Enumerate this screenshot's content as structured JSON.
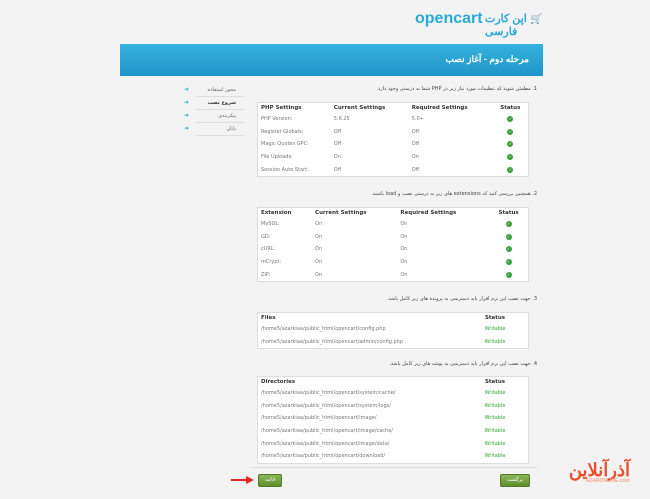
{
  "logo": {
    "brand": "opencart",
    "brand_fa": "اپن کارت فارسی"
  },
  "banner": {
    "title": "مرحله دوم - آغاز نصب"
  },
  "sidebar": {
    "items": [
      {
        "label": "مجوز استفاده",
        "active": false
      },
      {
        "label": "شروع نصب",
        "active": true
      },
      {
        "label": "پیکربندی",
        "active": false
      },
      {
        "label": "پایان",
        "active": false
      }
    ]
  },
  "section1": {
    "text": "1. مطمئن شوید که تنظیمات مورد نیاز زیر در PHP شما به درستی وجود دارد.",
    "headers": [
      "PHP Settings",
      "Current Settings",
      "Required Settings",
      "Status"
    ],
    "rows": [
      [
        "PHP Version:",
        "5.6.25",
        "5.0+"
      ],
      [
        "Register Globals:",
        "Off",
        "Off"
      ],
      [
        "Magic Quotes GPC:",
        "Off",
        "Off"
      ],
      [
        "File Uploads:",
        "On",
        "On"
      ],
      [
        "Session Auto Start:",
        "Off",
        "Off"
      ]
    ]
  },
  "section2": {
    "text": "2. همچنین بررسی کنید که extensions های زیر به درستی نصب و load باشند.",
    "headers": [
      "Extension",
      "Current Settings",
      "Required Settings",
      "Status"
    ],
    "rows": [
      [
        "MySQL:",
        "On",
        "On"
      ],
      [
        "GD:",
        "On",
        "On"
      ],
      [
        "cURL:",
        "On",
        "On"
      ],
      [
        "mCrypt:",
        "On",
        "On"
      ],
      [
        "ZIP:",
        "On",
        "On"
      ]
    ]
  },
  "section3": {
    "text": "3. جهت نصب این نرم افزار باید دسترسی به پرونده های زیر کامل باشد.",
    "headers": [
      "Files",
      "Status"
    ],
    "rows": [
      [
        "/home5/azarkiaa/public_html/opencart/config.php",
        "Writable"
      ],
      [
        "/home5/azarkiaa/public_html/opencart/admin/config.php",
        "Writable"
      ]
    ]
  },
  "section4": {
    "text": "4. جهت نصب این نرم افزار باید دسترسی به پوشه های زیر کامل باشد.",
    "headers": [
      "Directories",
      "Status"
    ],
    "rows": [
      [
        "/home5/azarkiaa/public_html/opencart/system/cache/",
        "Writable"
      ],
      [
        "/home5/azarkiaa/public_html/opencart/system/logs/",
        "Writable"
      ],
      [
        "/home5/azarkiaa/public_html/opencart/image/",
        "Writable"
      ],
      [
        "/home5/azarkiaa/public_html/opencart/image/cache/",
        "Writable"
      ],
      [
        "/home5/azarkiaa/public_html/opencart/image/data/",
        "Writable"
      ],
      [
        "/home5/azarkiaa/public_html/opencart/download/",
        "Writable"
      ]
    ]
  },
  "buttons": {
    "continue": "ادامه",
    "back": "برگشت"
  },
  "watermark": {
    "fa": "آذرآنلاین",
    "en": "AZARONLINE.com"
  },
  "colors": {
    "accent": "#2aa9d8",
    "ok": "#3aa13a",
    "button": "#6b9a3a",
    "arrow": "#e3261e"
  }
}
